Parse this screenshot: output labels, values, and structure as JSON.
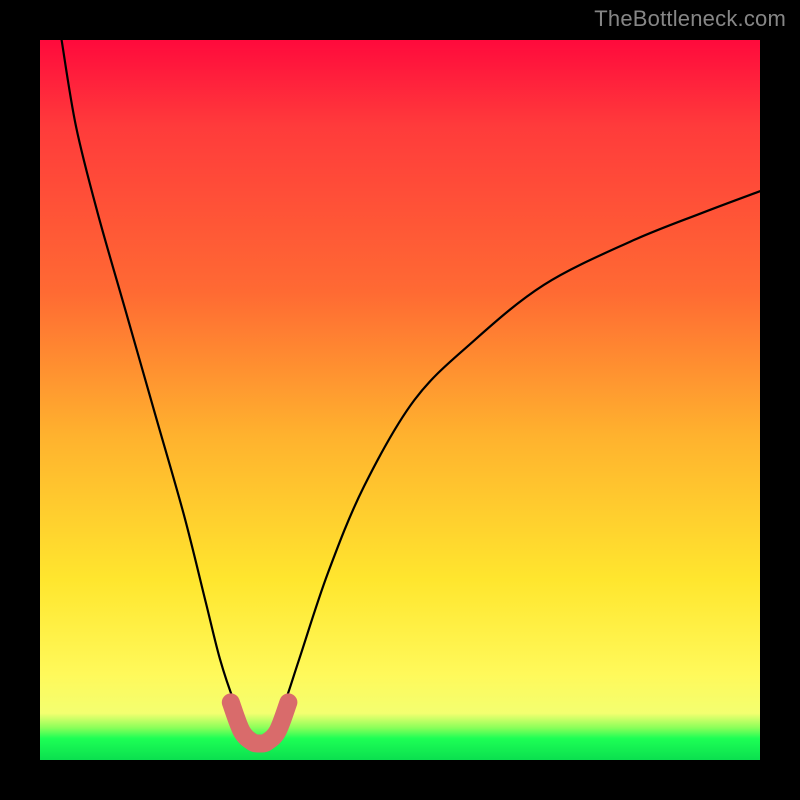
{
  "watermark": "TheBottleneck.com",
  "chart_data": {
    "type": "line",
    "title": "",
    "xlabel": "",
    "ylabel": "",
    "xlim": [
      0,
      100
    ],
    "ylim": [
      0,
      100
    ],
    "series": [
      {
        "name": "bottleneck-curve",
        "x": [
          3,
          5,
          8,
          12,
          16,
          20,
          23,
          25,
          27,
          29,
          30.5,
          32,
          34,
          36,
          40,
          45,
          52,
          60,
          70,
          82,
          92,
          100
        ],
        "y": [
          100,
          88,
          76,
          62,
          48,
          34,
          22,
          14,
          8,
          3.5,
          2.5,
          3.5,
          8,
          14,
          26,
          38,
          50,
          58,
          66,
          72,
          76,
          79
        ]
      },
      {
        "name": "highlight-band",
        "x": [
          26.5,
          28,
          29.5,
          30.5,
          31.5,
          33,
          34.5
        ],
        "y": [
          8,
          4,
          2.5,
          2.3,
          2.5,
          4,
          8
        ]
      }
    ],
    "gradient_stops": [
      {
        "pos": 0,
        "color": "#ff0a3c"
      },
      {
        "pos": 0.12,
        "color": "#ff3b3b"
      },
      {
        "pos": 0.35,
        "color": "#ff6a33"
      },
      {
        "pos": 0.55,
        "color": "#ffb22e"
      },
      {
        "pos": 0.75,
        "color": "#ffe62e"
      },
      {
        "pos": 0.88,
        "color": "#fff95a"
      },
      {
        "pos": 0.935,
        "color": "#f4ff70"
      },
      {
        "pos": 0.955,
        "color": "#8cff5a"
      },
      {
        "pos": 0.97,
        "color": "#1dff55"
      },
      {
        "pos": 1.0,
        "color": "#0bdf4f"
      }
    ],
    "highlight_color": "#d96b6b",
    "curve_color": "#000000"
  }
}
